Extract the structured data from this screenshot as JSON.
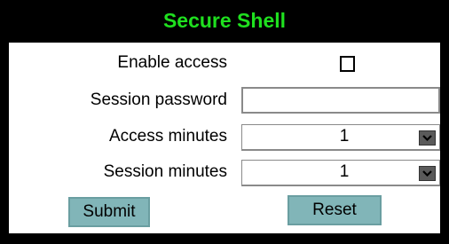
{
  "header": {
    "title": "Secure Shell"
  },
  "fields": {
    "enable_access": {
      "label": "Enable access",
      "checked": false
    },
    "session_password": {
      "label": "Session password",
      "value": ""
    },
    "access_minutes": {
      "label": "Access minutes",
      "value": "1"
    },
    "session_minutes": {
      "label": "Session minutes",
      "value": "1"
    }
  },
  "buttons": {
    "submit": "Submit",
    "reset": "Reset"
  },
  "colors": {
    "title": "#1fe01f",
    "button_bg": "#81b5b8",
    "background": "#000000"
  },
  "icons": {
    "dropdown": "chevron-down-icon"
  }
}
